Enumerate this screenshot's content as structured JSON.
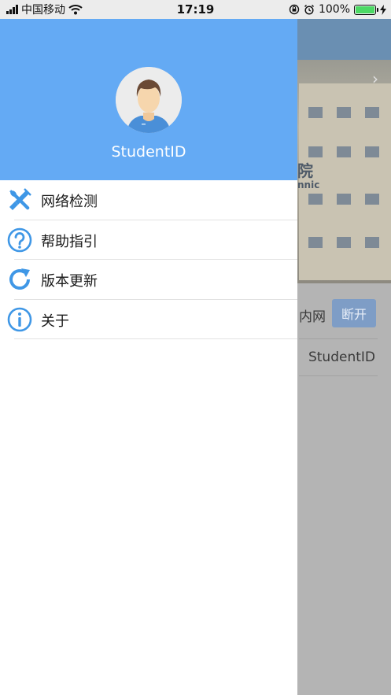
{
  "status_bar": {
    "carrier": "中国移动",
    "time": "17:19",
    "battery": "100%"
  },
  "drawer": {
    "username": "StudentID",
    "menu": [
      {
        "label": "网络检测",
        "icon": "wrench-screwdriver-icon"
      },
      {
        "label": "帮助指引",
        "icon": "question-circle-icon"
      },
      {
        "label": "版本更新",
        "icon": "refresh-icon"
      },
      {
        "label": "关于",
        "icon": "info-circle-icon"
      }
    ]
  },
  "background": {
    "school_name_partial": "院",
    "school_name_en_partial": "nnic",
    "row1_label_partial": "内网",
    "disconnect_button": "断开",
    "row2_value": "StudentID"
  },
  "colors": {
    "drawer_header": "#64aaf4",
    "icon_blue": "#3f97e6",
    "battery_green": "#4cd964"
  }
}
